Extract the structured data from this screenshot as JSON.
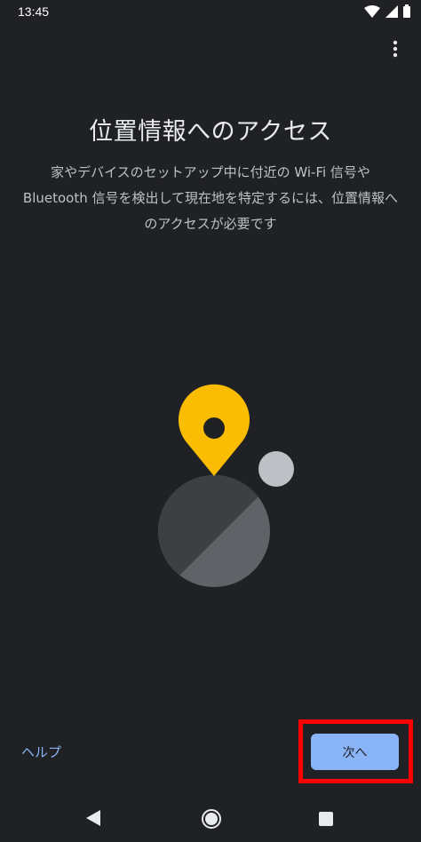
{
  "status_bar": {
    "time": "13:45",
    "icons": [
      "wifi-icon",
      "signal-icon",
      "battery-icon"
    ]
  },
  "toolbar": {
    "menu_icon": "more-vert-icon"
  },
  "content": {
    "title": "位置情報へのアクセス",
    "description": "家やデバイスのセットアップ中に付近の Wi-Fi 信号や Bluetooth 信号を検出して現在地を特定するには、位置情報へのアクセスが必要です"
  },
  "illustration": {
    "pin_color": "#fbbc04",
    "globe_dark": "#3c4043",
    "globe_light": "#5f6368",
    "moon_color": "#bdc1c6"
  },
  "footer": {
    "help_label": "ヘルプ",
    "next_label": "次へ"
  },
  "nav_bar": {
    "icons": [
      "back-icon",
      "home-icon",
      "recents-icon"
    ]
  },
  "colors": {
    "background": "#202124",
    "accent": "#8ab4f8",
    "highlight": "#ff0000"
  }
}
